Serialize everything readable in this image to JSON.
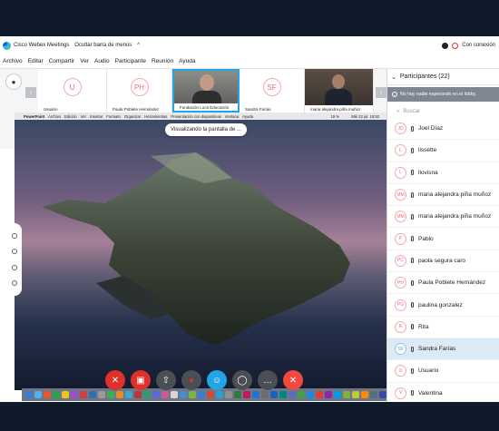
{
  "app": {
    "title": "Cisco Webex Meetings",
    "hide_menu": "Ocultar barra de menús",
    "connection": "Con conexión"
  },
  "menu": [
    "Archivo",
    "Editar",
    "Compartir",
    "Ver",
    "Audio",
    "Participante",
    "Reunión",
    "Ayuda"
  ],
  "thumbnails": [
    {
      "initials": "U",
      "name": "Usuario",
      "video": false
    },
    {
      "initials": "PH",
      "name": "Paula Poblete Hernández",
      "video": false
    },
    {
      "initials": "",
      "name": "Fundación Loca Educación",
      "video": true,
      "active": true
    },
    {
      "initials": "SF",
      "name": "Sandra Farías",
      "video": false
    },
    {
      "initials": "",
      "name": "maria alejandra piña muñoz",
      "video": true
    }
  ],
  "share_pill": "Visualizando la pantalla de ...",
  "mac_menu": [
    "PowerPoint",
    "Archivo",
    "Edición",
    "Ver",
    "Insertar",
    "Formato",
    "Organizar",
    "Herramientas",
    "Presentación con diapositivas",
    "Ventana",
    "Ayuda"
  ],
  "mac_clock": "Mié 22 jul. 15:53",
  "mac_battery": "19 %",
  "panel": {
    "title": "Participantes (22)",
    "lobby": "No hay nadie esperando en el lobby.",
    "search_placeholder": "Buscar",
    "participants": [
      {
        "initials": "JD",
        "name": "Joel Díaz"
      },
      {
        "initials": "L",
        "name": "lissette"
      },
      {
        "initials": "L",
        "name": "llovisna"
      },
      {
        "initials": "MM",
        "name": "maria alejandra piña muñoz"
      },
      {
        "initials": "MM",
        "name": "maria alejandra piña muñoz"
      },
      {
        "initials": "P",
        "name": "Pablo"
      },
      {
        "initials": "PC",
        "name": "paola segura caro"
      },
      {
        "initials": "PH",
        "name": "Paula Poblete Hernández"
      },
      {
        "initials": "PG",
        "name": "paulina gonzalez"
      },
      {
        "initials": "R",
        "name": "Rita"
      },
      {
        "initials": "SF",
        "name": "Sandra Farías",
        "selected": true
      },
      {
        "initials": "U",
        "name": "Usuario"
      },
      {
        "initials": "V",
        "name": "Valentina"
      }
    ]
  },
  "colors": {
    "accent": "#23a5e5",
    "danger": "#e0302a",
    "leave": "#f04a3e"
  }
}
